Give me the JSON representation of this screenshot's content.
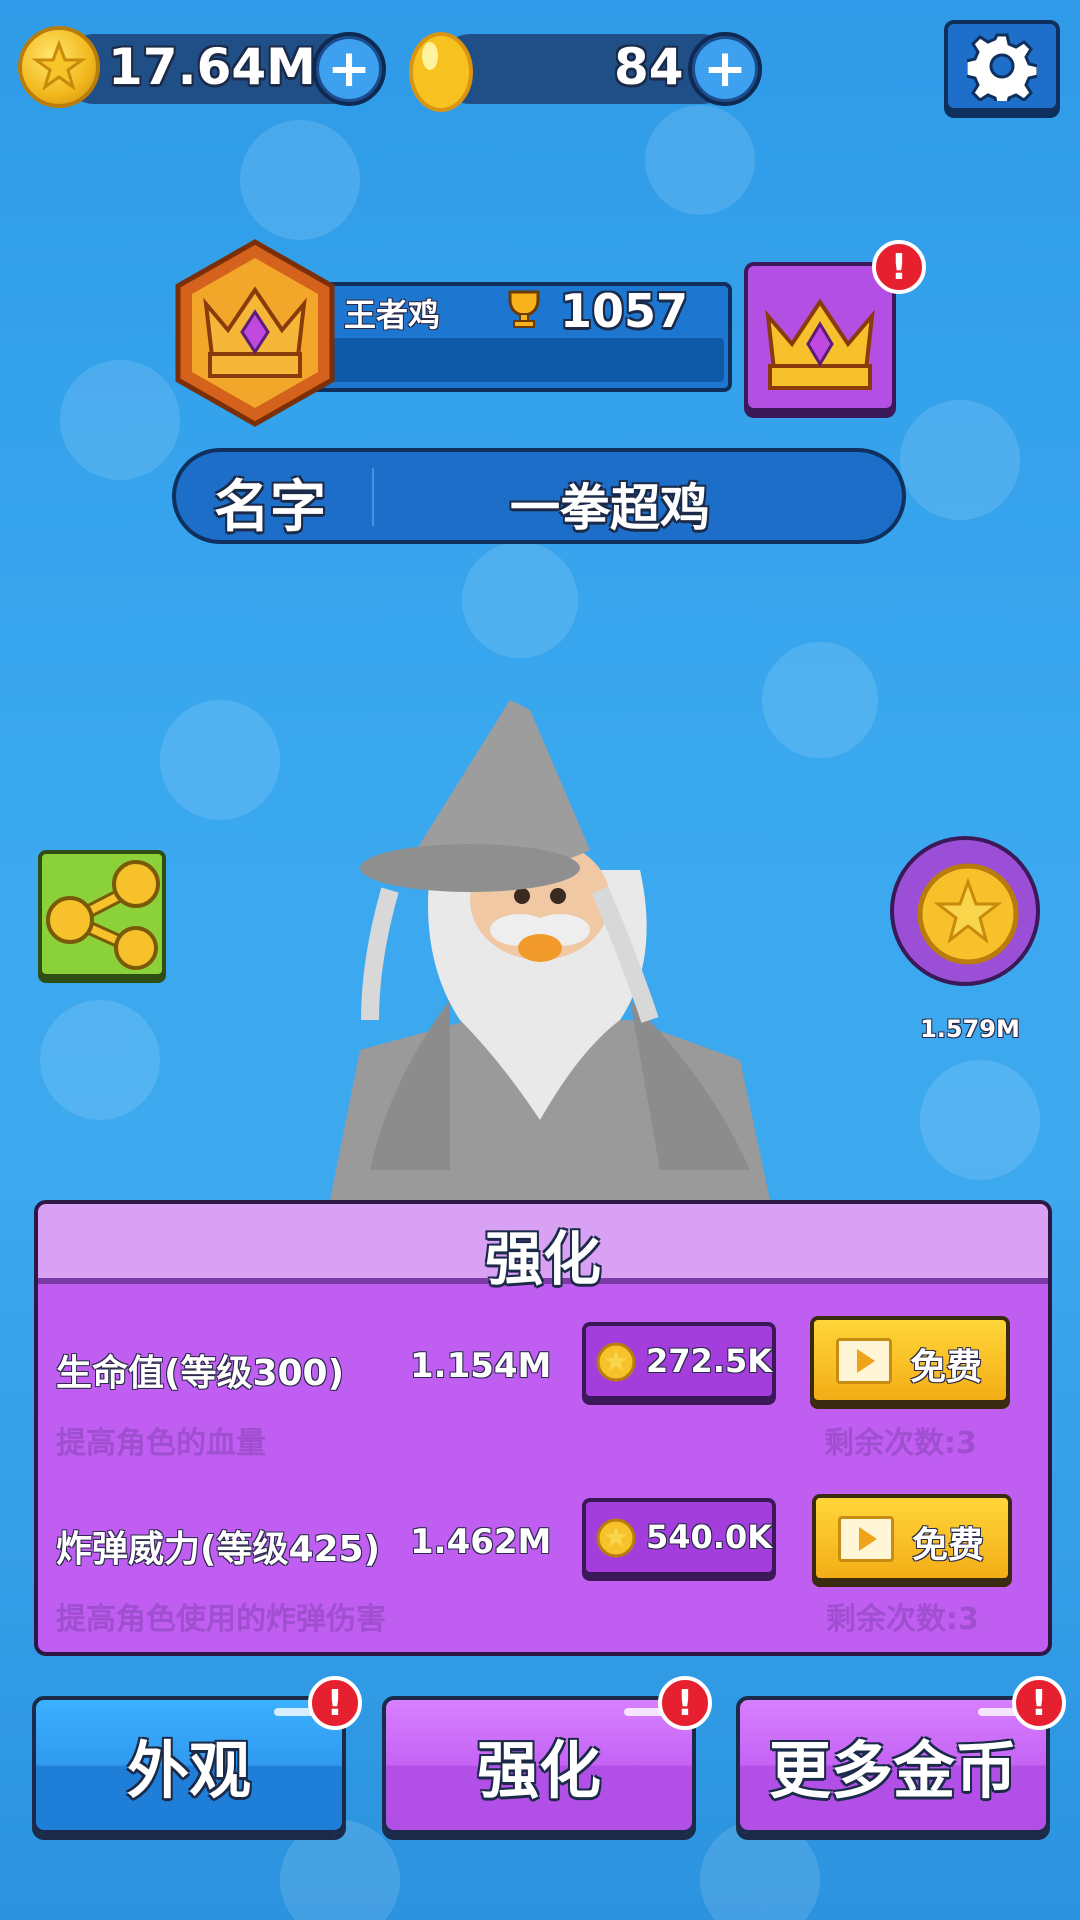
{
  "currency": {
    "gold": "17.64M",
    "eggs": "84"
  },
  "rank": {
    "title": "王者鸡",
    "trophies": "1057"
  },
  "profile": {
    "name_label": "名字",
    "name_value": "一拳超鸡"
  },
  "bonus": {
    "value": "1.579M"
  },
  "upgrade_panel": {
    "title": "强化",
    "items": [
      {
        "name": "生命值(等级300)",
        "value": "1.154M",
        "description": "提高角色的血量",
        "cost": "272.5K",
        "free_label": "免费",
        "remaining": "剩余次数:3"
      },
      {
        "name": "炸弹威力(等级425)",
        "value": "1.462M",
        "description": "提高角色使用的炸弹伤害",
        "cost": "540.0K",
        "free_label": "免费",
        "remaining": "剩余次数:3"
      }
    ]
  },
  "bottom_nav": {
    "appearance": "外观",
    "upgrade": "强化",
    "more_coins": "更多金币"
  },
  "alert_mark": "!",
  "colors": {
    "background": "#3aa8ef",
    "panel": "#c05ef2",
    "free_button": "#ffd63a"
  }
}
